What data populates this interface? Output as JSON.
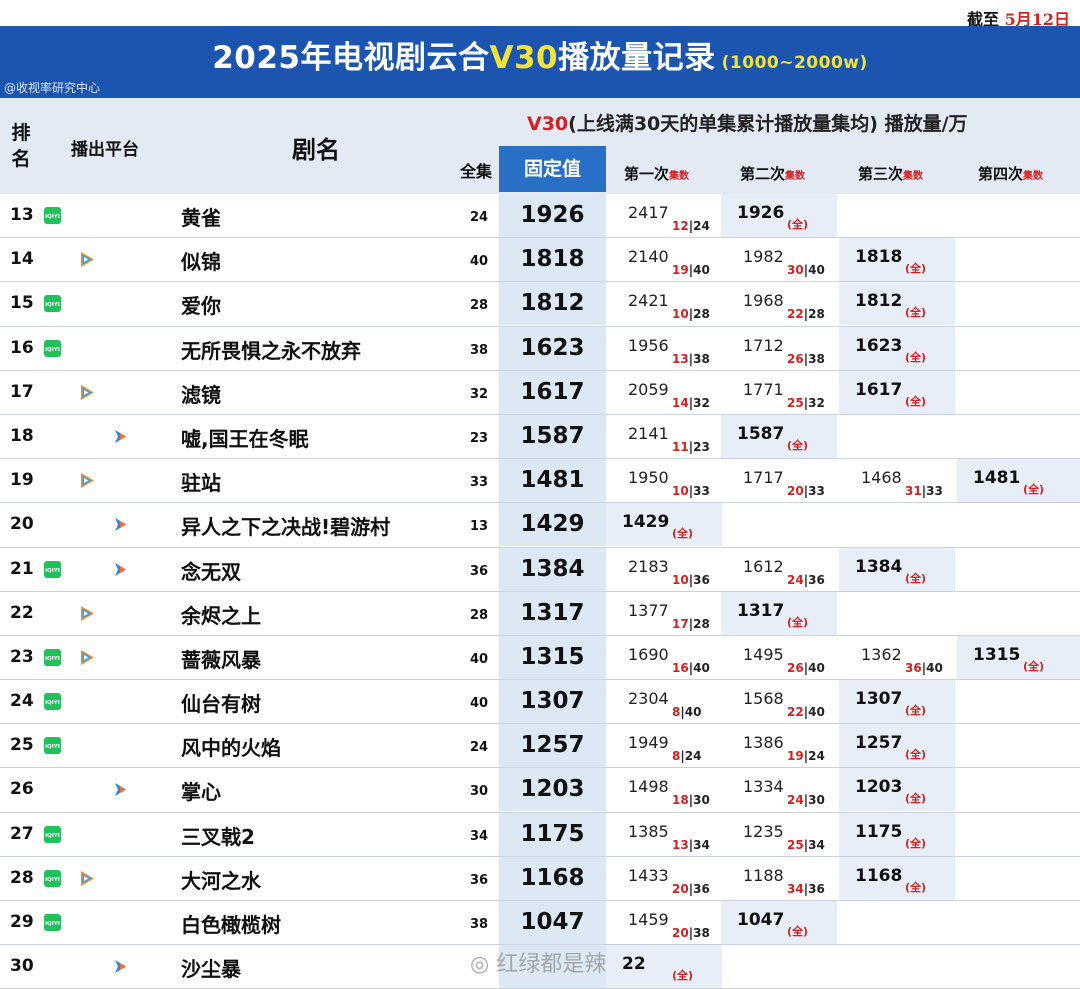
{
  "stamp": {
    "prefix": "截至",
    "date": "5月12日"
  },
  "banner": {
    "title_a": "2025年电视剧云合",
    "title_v30": "V30",
    "title_b": "播放量记录",
    "range": "(1000~2000w)",
    "credit": "@收视率研究中心"
  },
  "header": {
    "rank": "排名",
    "platform": "播出平台",
    "title": "剧名",
    "full": "全集",
    "v30_label": "V30",
    "v30_desc": "(上线满30天的单集累计播放量集均) 播放量/万",
    "fixed": "固定值",
    "attempts": [
      {
        "label": "第一次",
        "sub": "集数"
      },
      {
        "label": "第二次",
        "sub": "集数"
      },
      {
        "label": "第三次",
        "sub": "集数"
      },
      {
        "label": "第四次",
        "sub": "集数"
      }
    ]
  },
  "full_mark": "(全)",
  "colors": {
    "iqiyi": "#20c05a",
    "tencent": "#27a3f5",
    "youku": "#1e8af5",
    "banner": "#1b55b0",
    "accent_red": "#d42020"
  },
  "rows": [
    {
      "rank": "13",
      "platforms": [
        "iqiyi"
      ],
      "title": "黄雀",
      "eps": "24",
      "fixed": "1926",
      "records": [
        {
          "v": "2417",
          "ep": "12",
          "tot": "24"
        },
        {
          "v": "1926",
          "full": true
        }
      ]
    },
    {
      "rank": "14",
      "platforms": [
        "tencent"
      ],
      "title": "似锦",
      "eps": "40",
      "fixed": "1818",
      "records": [
        {
          "v": "2140",
          "ep": "19",
          "tot": "40"
        },
        {
          "v": "1982",
          "ep": "30",
          "tot": "40"
        },
        {
          "v": "1818",
          "full": true
        }
      ]
    },
    {
      "rank": "15",
      "platforms": [
        "iqiyi"
      ],
      "title": "爱你",
      "eps": "28",
      "fixed": "1812",
      "records": [
        {
          "v": "2421",
          "ep": "10",
          "tot": "28"
        },
        {
          "v": "1968",
          "ep": "22",
          "tot": "28"
        },
        {
          "v": "1812",
          "full": true
        }
      ]
    },
    {
      "rank": "16",
      "platforms": [
        "iqiyi"
      ],
      "title": "无所畏惧之永不放弃",
      "eps": "38",
      "fixed": "1623",
      "records": [
        {
          "v": "1956",
          "ep": "13",
          "tot": "38"
        },
        {
          "v": "1712",
          "ep": "26",
          "tot": "38"
        },
        {
          "v": "1623",
          "full": true
        }
      ]
    },
    {
      "rank": "17",
      "platforms": [
        "tencent"
      ],
      "title": "滤镜",
      "eps": "32",
      "fixed": "1617",
      "records": [
        {
          "v": "2059",
          "ep": "14",
          "tot": "32"
        },
        {
          "v": "1771",
          "ep": "25",
          "tot": "32"
        },
        {
          "v": "1617",
          "full": true
        }
      ]
    },
    {
      "rank": "18",
      "platforms": [
        "youku"
      ],
      "title": "嘘,国王在冬眠",
      "eps": "23",
      "fixed": "1587",
      "records": [
        {
          "v": "2141",
          "ep": "11",
          "tot": "23"
        },
        {
          "v": "1587",
          "full": true
        }
      ]
    },
    {
      "rank": "19",
      "platforms": [
        "tencent"
      ],
      "title": "驻站",
      "eps": "33",
      "fixed": "1481",
      "records": [
        {
          "v": "1950",
          "ep": "10",
          "tot": "33"
        },
        {
          "v": "1717",
          "ep": "20",
          "tot": "33"
        },
        {
          "v": "1468",
          "ep": "31",
          "tot": "33"
        },
        {
          "v": "1481",
          "full": true
        }
      ]
    },
    {
      "rank": "20",
      "platforms": [
        "youku"
      ],
      "title": "异人之下之决战!碧游村",
      "eps": "13",
      "fixed": "1429",
      "records": [
        {
          "v": "1429",
          "full": true
        }
      ]
    },
    {
      "rank": "21",
      "platforms": [
        "iqiyi",
        "youku"
      ],
      "title": "念无双",
      "eps": "36",
      "fixed": "1384",
      "records": [
        {
          "v": "2183",
          "ep": "10",
          "tot": "36"
        },
        {
          "v": "1612",
          "ep": "24",
          "tot": "36"
        },
        {
          "v": "1384",
          "full": true
        }
      ]
    },
    {
      "rank": "22",
      "platforms": [
        "tencent"
      ],
      "title": "余烬之上",
      "eps": "28",
      "fixed": "1317",
      "records": [
        {
          "v": "1377",
          "ep": "17",
          "tot": "28"
        },
        {
          "v": "1317",
          "full": true
        }
      ]
    },
    {
      "rank": "23",
      "platforms": [
        "iqiyi",
        "tencent"
      ],
      "title": "蔷薇风暴",
      "eps": "40",
      "fixed": "1315",
      "records": [
        {
          "v": "1690",
          "ep": "16",
          "tot": "40"
        },
        {
          "v": "1495",
          "ep": "26",
          "tot": "40"
        },
        {
          "v": "1362",
          "ep": "36",
          "tot": "40"
        },
        {
          "v": "1315",
          "full": true
        }
      ]
    },
    {
      "rank": "24",
      "platforms": [
        "iqiyi"
      ],
      "title": "仙台有树",
      "eps": "40",
      "fixed": "1307",
      "records": [
        {
          "v": "2304",
          "ep": "8",
          "tot": "40"
        },
        {
          "v": "1568",
          "ep": "22",
          "tot": "40"
        },
        {
          "v": "1307",
          "full": true
        }
      ]
    },
    {
      "rank": "25",
      "platforms": [
        "iqiyi"
      ],
      "title": "风中的火焰",
      "eps": "24",
      "fixed": "1257",
      "records": [
        {
          "v": "1949",
          "ep": "8",
          "tot": "24"
        },
        {
          "v": "1386",
          "ep": "19",
          "tot": "24"
        },
        {
          "v": "1257",
          "full": true
        }
      ]
    },
    {
      "rank": "26",
      "platforms": [
        "youku"
      ],
      "title": "掌心",
      "eps": "30",
      "fixed": "1203",
      "records": [
        {
          "v": "1498",
          "ep": "18",
          "tot": "30"
        },
        {
          "v": "1334",
          "ep": "24",
          "tot": "30"
        },
        {
          "v": "1203",
          "full": true
        }
      ]
    },
    {
      "rank": "27",
      "platforms": [
        "iqiyi"
      ],
      "title": "三叉戟2",
      "eps": "34",
      "fixed": "1175",
      "records": [
        {
          "v": "1385",
          "ep": "13",
          "tot": "34"
        },
        {
          "v": "1235",
          "ep": "25",
          "tot": "34"
        },
        {
          "v": "1175",
          "full": true
        }
      ]
    },
    {
      "rank": "28",
      "platforms": [
        "iqiyi",
        "tencent"
      ],
      "title": "大河之水",
      "eps": "36",
      "fixed": "1168",
      "records": [
        {
          "v": "1433",
          "ep": "20",
          "tot": "36"
        },
        {
          "v": "1188",
          "ep": "34",
          "tot": "36"
        },
        {
          "v": "1168",
          "full": true
        }
      ]
    },
    {
      "rank": "29",
      "platforms": [
        "iqiyi"
      ],
      "title": "白色橄榄树",
      "eps": "38",
      "fixed": "1047",
      "records": [
        {
          "v": "1459",
          "ep": "20",
          "tot": "38"
        },
        {
          "v": "1047",
          "full": true
        }
      ]
    },
    {
      "rank": "30",
      "platforms": [
        "youku"
      ],
      "title": "沙尘暴",
      "eps": "",
      "fixed": "",
      "records": [
        {
          "v": "22",
          "full": true
        }
      ]
    }
  ],
  "watermark": "红绿都是辣"
}
